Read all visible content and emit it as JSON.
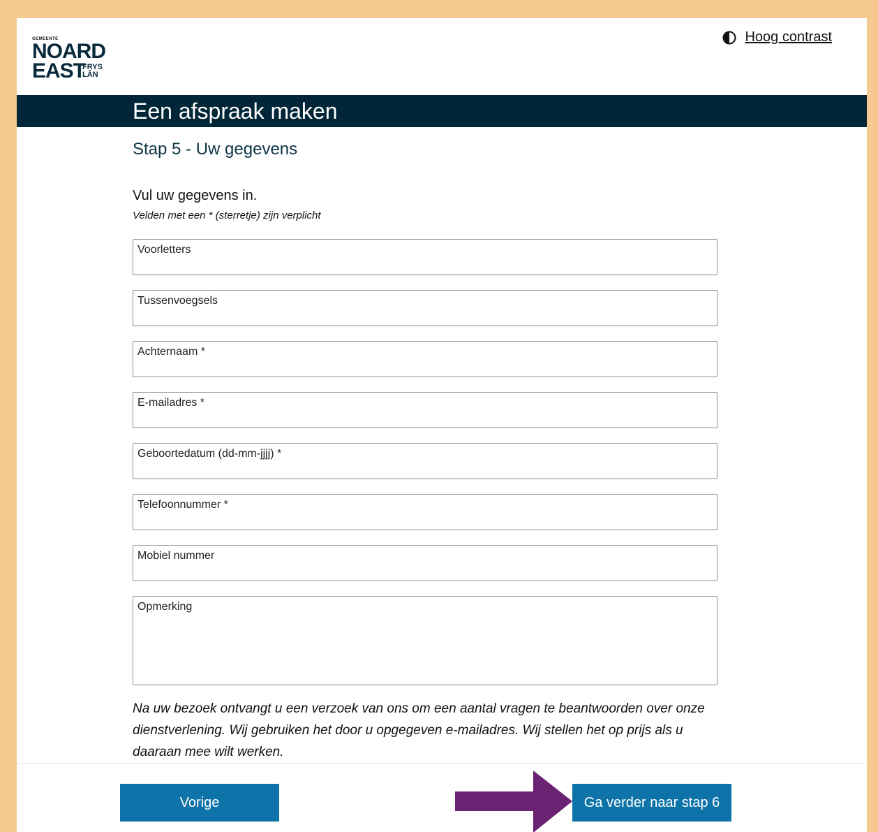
{
  "header": {
    "logo": {
      "small": "GEMEENTE",
      "line1": "NOARD",
      "line2": "EAST",
      "line3a": "FRYS",
      "line3b": "LÂN"
    },
    "contrast_label": "Hoog contrast",
    "contrast_icon": "contrast-icon"
  },
  "banner": {
    "title": "Een afspraak maken"
  },
  "form": {
    "step_title": "Stap 5 - Uw gegevens",
    "intro": "Vul uw gegevens in.",
    "required_note": "Velden met een * (sterretje) zijn verplicht",
    "fields": [
      {
        "label": "Voorletters"
      },
      {
        "label": "Tussenvoegsels"
      },
      {
        "label": "Achternaam *"
      },
      {
        "label": "E-mailadres *"
      },
      {
        "label": "Geboortedatum (dd-mm-jjjj) *"
      },
      {
        "label": "Telefoonnummer *"
      },
      {
        "label": "Mobiel nummer"
      },
      {
        "label": "Opmerking"
      }
    ],
    "footnote": "Na uw bezoek ontvangt u een verzoek van ons om een aantal vragen te beantwoorden over onze dienstverlening. Wij gebruiken het door u opgegeven e-mailadres. Wij stellen het op prijs als u daaraan mee wilt werken."
  },
  "buttons": {
    "prev": "Vorige",
    "next": "Ga verder naar stap 6"
  },
  "colors": {
    "banner": "#002637",
    "button": "#0e73a8",
    "arrow": "#6a2272",
    "outer": "#f5c98f"
  }
}
